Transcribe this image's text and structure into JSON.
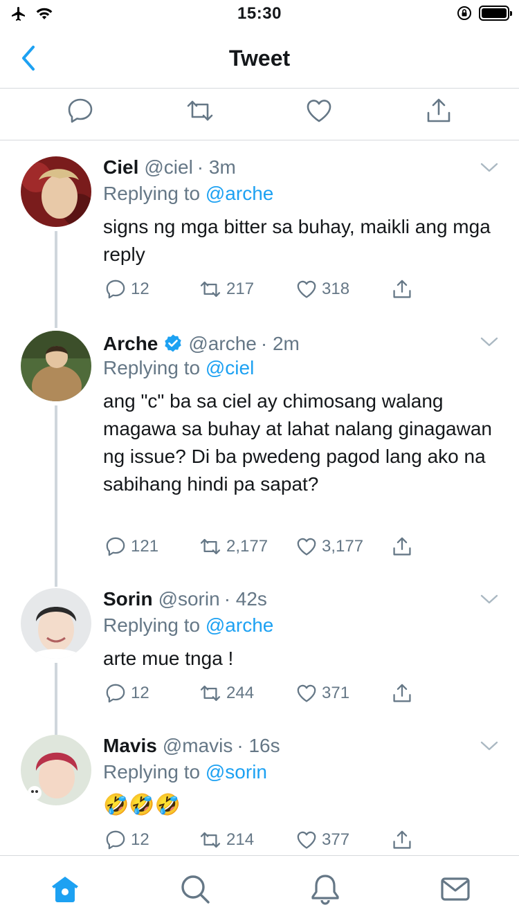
{
  "status_bar": {
    "time": "15:30",
    "icons": [
      "airplane-icon",
      "wifi-icon",
      "orientation-lock-icon",
      "battery-icon"
    ]
  },
  "nav": {
    "title": "Tweet",
    "back_icon": "chevron-left-icon"
  },
  "colors": {
    "accent": "#1da1f2",
    "text": "#14171a",
    "secondary": "#657786",
    "divider": "#d6d9dc",
    "thread_line": "#cfd6dc"
  },
  "tweets": [
    {
      "name": "Ciel",
      "handle": "@ciel",
      "time": "· 3m",
      "verified": false,
      "replying_prefix": "Replying to ",
      "replying_to": "@arche",
      "body": "signs ng mga bitter sa buhay, maikli ang mga reply",
      "replies": "12",
      "retweets": "217",
      "likes": "318"
    },
    {
      "name": "Arche",
      "handle": "@arche",
      "time": "· 2m",
      "verified": true,
      "replying_prefix": "Replying to ",
      "replying_to": "@ciel",
      "body": "ang \"c\" ba sa ciel ay chimosang walang magawa sa buhay at lahat nalang ginagawan ng issue? Di ba pwedeng pagod lang ako na sabihang hindi pa sapat?",
      "replies": "121",
      "retweets": "2,177",
      "likes": "3,177"
    },
    {
      "name": "Sorin",
      "handle": "@sorin",
      "time": "· 42s",
      "verified": false,
      "replying_prefix": "Replying to ",
      "replying_to": "@arche",
      "body": "arte mue tnga !",
      "replies": "12",
      "retweets": "244",
      "likes": "371"
    },
    {
      "name": "Mavis",
      "handle": "@mavis",
      "time": "· 16s",
      "verified": false,
      "replying_prefix": "Replying to ",
      "replying_to": "@sorin",
      "body": "🤣🤣🤣",
      "replies": "12",
      "retweets": "214",
      "likes": "377"
    }
  ],
  "tab_bar": [
    "home-icon",
    "search-icon",
    "notifications-icon",
    "messages-icon"
  ]
}
